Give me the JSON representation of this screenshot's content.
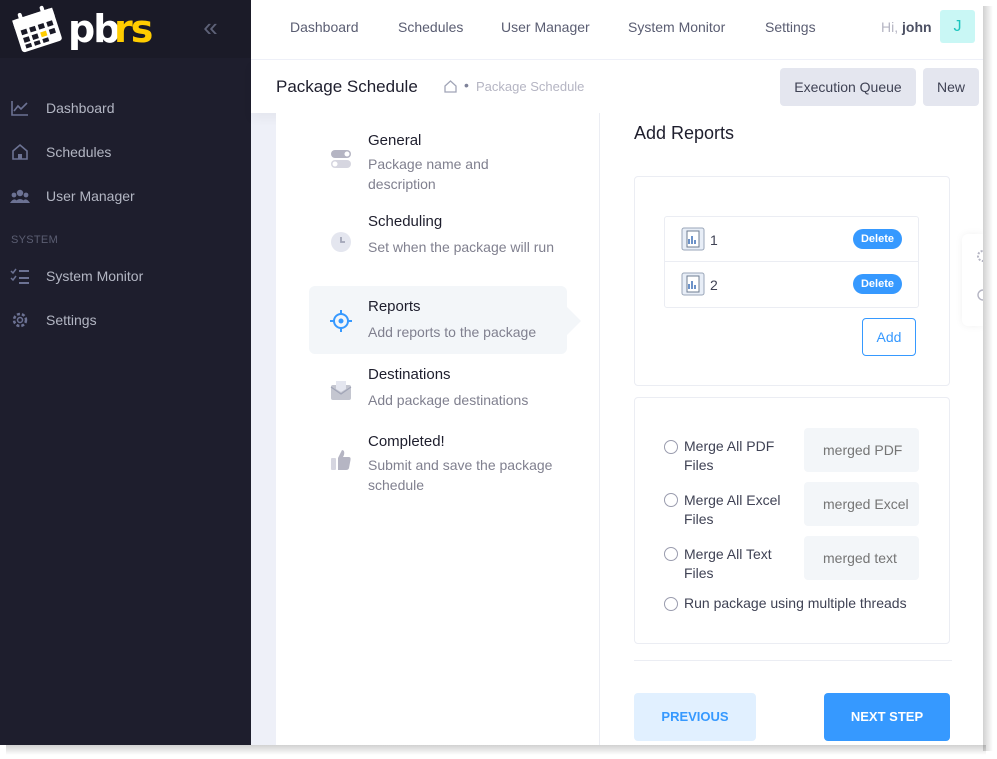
{
  "brand": {
    "logo_text": "pbrs"
  },
  "sidebar": {
    "collapse_icon": "double-chevron-left-icon",
    "items": [
      {
        "label": "Dashboard",
        "icon": "chart-line-icon"
      },
      {
        "label": "Schedules",
        "icon": "home-icon"
      },
      {
        "label": "User Manager",
        "icon": "users-icon"
      }
    ],
    "section_label": "SYSTEM",
    "system_items": [
      {
        "label": "System Monitor",
        "icon": "list-check-icon"
      },
      {
        "label": "Settings",
        "icon": "gear-icon"
      }
    ]
  },
  "header": {
    "menu": [
      "Dashboard",
      "Schedules",
      "User Manager",
      "System Monitor",
      "Settings"
    ],
    "greeting": "Hi,",
    "username": "john",
    "avatar_letter": "J"
  },
  "subheader": {
    "title": "Package Schedule",
    "breadcrumb": "Package Schedule",
    "execution_queue_label": "Execution Queue",
    "new_label": "New"
  },
  "wizard": {
    "steps": [
      {
        "title": "General",
        "desc": "Package name and description",
        "icon": "toggle-icon"
      },
      {
        "title": "Scheduling",
        "desc": "Set when the package will run",
        "icon": "clock-icon"
      },
      {
        "title": "Reports",
        "desc": "Add reports to the package",
        "icon": "target-icon"
      },
      {
        "title": "Destinations",
        "desc": "Add package destinations",
        "icon": "mail-box-icon"
      },
      {
        "title": "Completed!",
        "desc": "Submit and save the package schedule",
        "icon": "thumbs-up-icon"
      }
    ],
    "active_step": "Reports"
  },
  "form": {
    "title": "Add Reports",
    "reports": [
      {
        "name": "1",
        "delete_label": "Delete"
      },
      {
        "name": "2",
        "delete_label": "Delete"
      }
    ],
    "add_label": "Add",
    "options": [
      {
        "label": "Merge All PDF Files",
        "placeholder": "merged PDF"
      },
      {
        "label": "Merge All Excel Files",
        "placeholder": "merged Excel"
      },
      {
        "label": "Merge All Text Files",
        "placeholder": "merged text"
      }
    ],
    "threads_label": "Run package using multiple threads",
    "previous_label": "PREVIOUS",
    "next_label": "NEXT STEP"
  },
  "colors": {
    "accent": "#3699ff",
    "sidebar_bg": "#1e1e2d",
    "avatar_bg": "#c9f7f5",
    "logo_yellow": "#ffcc00"
  }
}
